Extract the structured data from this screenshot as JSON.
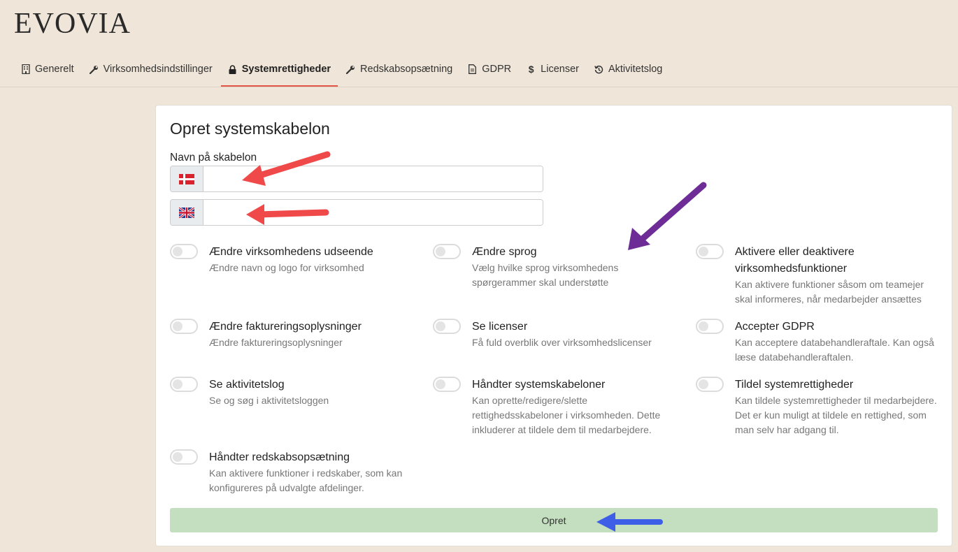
{
  "app": {
    "logo": "EVOVIA"
  },
  "tabs": [
    {
      "label": "Generelt",
      "icon": "building-icon"
    },
    {
      "label": "Virksomhedsindstillinger",
      "icon": "wrench-icon"
    },
    {
      "label": "Systemrettigheder",
      "icon": "lock-icon",
      "active": true
    },
    {
      "label": "Redskabsopsætning",
      "icon": "wrench-icon"
    },
    {
      "label": "GDPR",
      "icon": "document-icon"
    },
    {
      "label": "Licenser",
      "icon": "dollar-icon"
    },
    {
      "label": "Aktivitetslog",
      "icon": "history-icon"
    }
  ],
  "form": {
    "title": "Opret systemskabelon",
    "name_label": "Navn på skabelon",
    "name_da_value": "",
    "name_en_value": "",
    "submit_label": "Opret"
  },
  "permissions": [
    {
      "title": "Ændre virksomhedens udseende",
      "desc": "Ændre navn og logo for virksomhed",
      "enabled": false
    },
    {
      "title": "Ændre sprog",
      "desc": "Vælg hvilke sprog virksomhedens spørgerammer skal understøtte",
      "enabled": false
    },
    {
      "title": "Aktivere eller deaktivere virksomhedsfunktioner",
      "desc": "Kan aktivere funktioner såsom om teamejer skal informeres, når medarbejder ansættes",
      "enabled": false
    },
    {
      "title": "Ændre faktureringsoplysninger",
      "desc": "Ændre faktureringsoplysninger",
      "enabled": false
    },
    {
      "title": "Se licenser",
      "desc": "Få fuld overblik over virksomhedslicenser",
      "enabled": false
    },
    {
      "title": "Accepter GDPR",
      "desc": "Kan acceptere databehandleraftale. Kan også læse databehandleraftalen.",
      "enabled": false
    },
    {
      "title": "Se aktivitetslog",
      "desc": "Se og søg i aktivitetsloggen",
      "enabled": false
    },
    {
      "title": "Håndter systemskabeloner",
      "desc": "Kan oprette/redigere/slette rettighedsskabeloner i virksomheden. Dette inkluderer at tildele dem til medarbejdere.",
      "enabled": false
    },
    {
      "title": "Tildel systemrettigheder",
      "desc": "Kan tildele systemrettigheder til medarbejdere. Det er kun muligt at tildele en rettighed, som man selv har adgang til.",
      "enabled": false
    },
    {
      "title": "Håndter redskabsopsætning",
      "desc": "Kan aktivere funktioner i redskaber, som kan konfigureres på udvalgte afdelinger.",
      "enabled": false
    }
  ],
  "colors": {
    "background": "#efe5d8",
    "active_tab_underline": "#e05548",
    "submit_bg": "#c4dfbf",
    "annotation_red": "#f0494a",
    "annotation_purple": "#6e2d96",
    "annotation_blue": "#3f5ee8"
  }
}
